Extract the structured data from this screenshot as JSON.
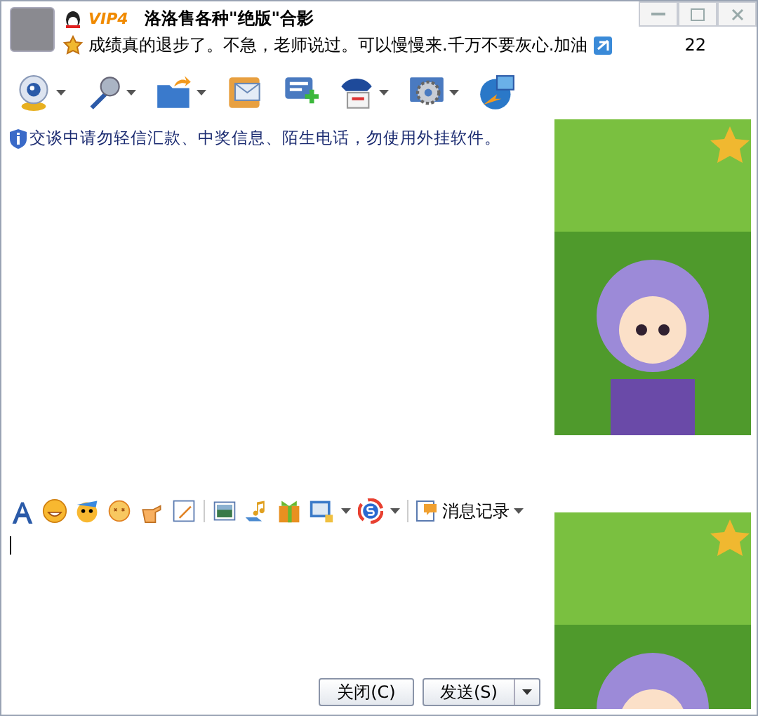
{
  "contact": {
    "vip": "VIP4",
    "name": "洛洛售各种\"绝版\"合影",
    "signature": "成绩真的退步了。不急，老师说过。可以慢慢来.千万不要灰心.加油",
    "count": "22"
  },
  "toolbar": [
    {
      "kind": "webcam",
      "menu": true
    },
    {
      "kind": "mic",
      "menu": true
    },
    {
      "kind": "folder",
      "menu": true
    },
    {
      "kind": "sms",
      "menu": false
    },
    {
      "kind": "addchat",
      "menu": false
    },
    {
      "kind": "police",
      "menu": true
    },
    {
      "kind": "settings",
      "menu": true
    },
    {
      "kind": "globe",
      "menu": false
    }
  ],
  "notice": "交谈中请勿轻信汇款、中奖信息、陌生电话，勿使用外挂软件。",
  "input_toolbar": [
    {
      "kind": "font"
    },
    {
      "kind": "smile"
    },
    {
      "kind": "magic"
    },
    {
      "kind": "shake"
    },
    {
      "kind": "hand"
    },
    {
      "kind": "edit"
    },
    {
      "kind": "image"
    },
    {
      "kind": "music"
    },
    {
      "kind": "gift"
    },
    {
      "kind": "screen"
    },
    {
      "kind": "sogou"
    }
  ],
  "history": "消息记录",
  "buttons": {
    "close": "关闭(C)",
    "send": "发送(S)"
  }
}
